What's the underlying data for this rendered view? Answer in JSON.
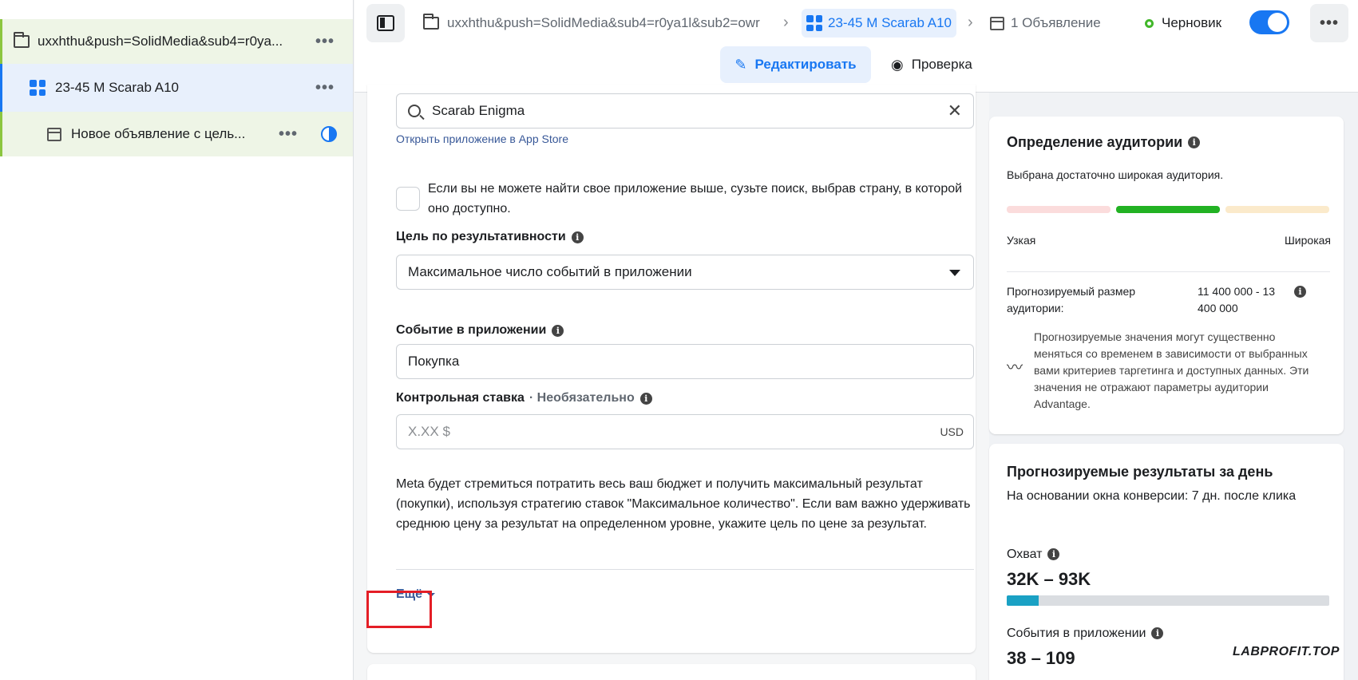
{
  "tree": {
    "campaign": {
      "label": "uxxhthu&push=SolidMedia&sub4=r0ya..."
    },
    "adset": {
      "label": "23-45 M Scarab A10"
    },
    "ad": {
      "label": "Новое объявление с цель..."
    },
    "more_glyph": "•••"
  },
  "topbar": {
    "campaign_crumb": "uxxhthu&push=SolidMedia&sub4=r0ya1l&sub2=owr",
    "adset_crumb": "23-45 M Scarab A10",
    "ad_crumb": "1 Объявление",
    "status": "Черновик",
    "toggle_on": true,
    "separator": "›",
    "more_glyph": "•••"
  },
  "tabs": {
    "edit": "Редактировать",
    "review": "Проверка"
  },
  "form": {
    "app_search_value": "Scarab Enigma",
    "app_store_link": "Открыть приложение в App Store",
    "not_found_checkbox_text": "Если вы не можете найти свое приложение выше, сузьте поиск, выбрав страну, в которой оно доступно.",
    "performance_goal_label": "Цель по результативности",
    "performance_goal_value": "Максимальное число событий в приложении",
    "app_event_label": "Событие в приложении",
    "app_event_value": "Покупка",
    "bid_cap_label": "Контрольная ставка",
    "bid_cap_optional": "· Необязательно",
    "bid_cap_placeholder": "X.XX $",
    "currency": "USD",
    "description": "Meta будет стремиться потратить весь ваш бюджет и получить максимальный результат (покупки), используя стратегию ставок \"Максимальное количество\". Если вам важно удерживать среднюю цену за результат на определенном уровне, укажите цель по цене за результат.",
    "more_link": "Ещё"
  },
  "audience": {
    "title": "Определение аудитории",
    "summary": "Выбрана достаточно широкая аудитория.",
    "narrow": "Узкая",
    "broad": "Широкая",
    "size_label": "Прогнозируемый размер аудитории:",
    "size_value": "11 400 000 - 13 400 000",
    "note": "Прогнозируемые значения могут существенно меняться со временем в зависимости от выбранных вами критериев таргетинга и доступных данных. Эти значения не отражают параметры аудитории Advantage."
  },
  "daily_results": {
    "title": "Прогнозируемые результаты за день",
    "basis": "На основании окна конверсии: 7 дн. после клика",
    "reach_label": "Охват",
    "reach_value": "32K – 93K",
    "reach_fill_fraction": 0.1,
    "events_label": "События в приложении",
    "events_value": "38 – 109"
  },
  "watermark": "LABPROFIT.TOP",
  "colors": {
    "accent": "#1877f2",
    "highlight_box": "#e41e26",
    "status_green": "#42b72a",
    "meter_selected": "#22b223",
    "reach_fill": "#1aa1c4"
  }
}
